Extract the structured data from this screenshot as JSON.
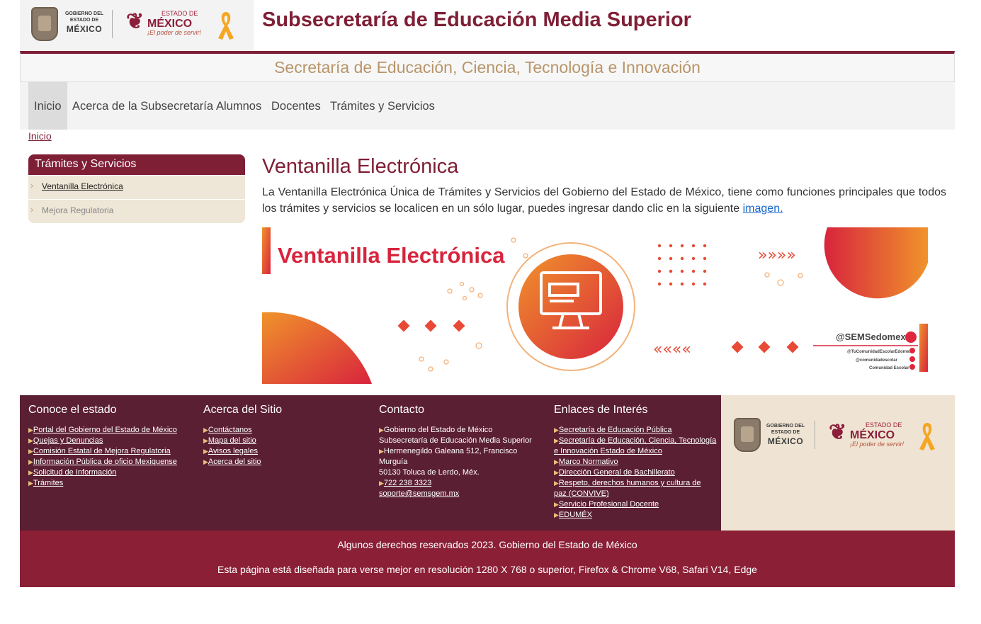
{
  "header": {
    "gov_line1": "GOBIERNO DEL",
    "gov_line2": "ESTADO DE",
    "gov_line3": "MÉXICO",
    "edo_label": "ESTADO DE",
    "edo_name": "MÉXICO",
    "edo_slogan": "¡El poder de servir!",
    "title": "Subsecretaría de Educación Media Superior",
    "subtitle": "Secretaría de Educación, Ciencia, Tecnología e Innovación"
  },
  "nav": {
    "items": [
      {
        "label": "Inicio"
      },
      {
        "label": "Acerca de la Subsecretaría"
      },
      {
        "label": "Alumnos"
      },
      {
        "label": "Docentes"
      },
      {
        "label": "Trámites y Servicios"
      }
    ]
  },
  "breadcrumb": {
    "label": "Inicio"
  },
  "sidebar": {
    "title": "Trámites y Servicios",
    "items": [
      {
        "label": "Ventanilla Electrónica"
      },
      {
        "label": "Mejora Regulatoria"
      }
    ]
  },
  "main": {
    "title": "Ventanilla Electrónica",
    "text": "La Ventanilla Electrónica Única de Trámites y Servicios del Gobierno del Estado de México, tiene como funciones principales que todos los trámites y servicios se localicen en un sólo lugar, puedes ingresar dando clic en la siguiente",
    "link": "imagen."
  },
  "banner": {
    "heading": "Ventanilla Electrónica",
    "handle": "@SEMSedomex",
    "social1": "@TuComunidadEscolarEdomex",
    "social2": "@comunidadescolar",
    "social3": "Comunidad Escolar",
    "colors": {
      "accent": "#d8243d",
      "orange": "#f0932b"
    }
  },
  "footer": {
    "col1": {
      "title": "Conoce el estado",
      "links": [
        "Portal del Gobierno del Estado de México",
        "Quejas y Denuncias",
        "Comisión Estatal de Mejora Regulatoria",
        "Información Pública de oficio Mexiquense",
        "Solicitud de Información",
        "Trámites"
      ]
    },
    "col2": {
      "title": "Acerca del Sitio",
      "links": [
        "Contáctanos",
        "Mapa del sitio",
        "Avisos legales",
        "Acerca del sitio"
      ]
    },
    "col3": {
      "title": "Contacto",
      "org1": "Gobierno del Estado de México",
      "org2": "Subsecretaría de Educación Media Superior",
      "addr1": "Hermenegildo Galeana 512, Francisco",
      "addr2": "Murguía",
      "addr3": "50130 Toluca de Lerdo, Méx.",
      "phone": "722 238 3323",
      "email": "soporte@semsgem.mx"
    },
    "col4": {
      "title": "Enlaces de Interés",
      "links": [
        "Secretaría de Educación Pública",
        "Secretaría de Educación, Ciencia, Tecnología",
        "e Innovación Estado de México",
        "Marco Normativo",
        "Dirección General de Bachillerato",
        "Respeto, derechos humanos y cultura de",
        "paz (CONVIVE)",
        "Servicio Profesional Docente",
        "EDUMÉX"
      ]
    }
  },
  "copyright": {
    "line1": "Algunos derechos reservados 2023. Gobierno del Estado de México",
    "line2": "Esta página está diseñada para verse mejor en resolución 1280 X 768 o superior, Firefox & Chrome V68, Safari V14, Edge"
  }
}
